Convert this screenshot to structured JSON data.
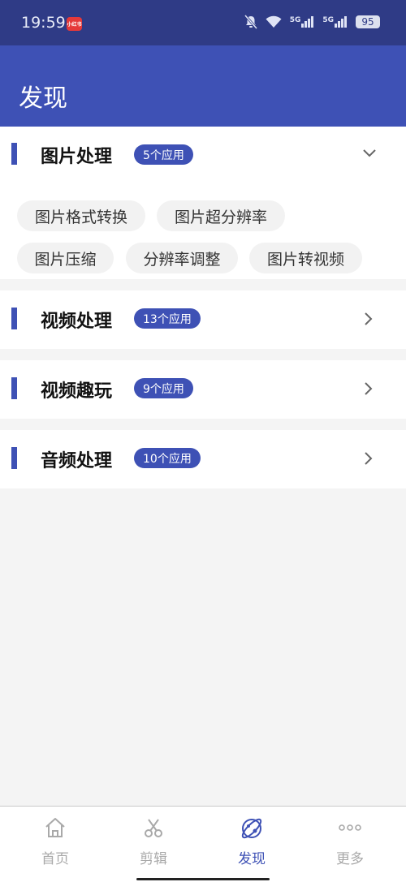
{
  "status_bar": {
    "time": "19:59",
    "app_badge": "小红书",
    "signal_1": "5G",
    "signal_2": "5G",
    "battery": "95"
  },
  "header": {
    "title": "发现"
  },
  "sections": [
    {
      "title": "图片处理",
      "count": "5个应用",
      "expanded": true,
      "chips": [
        "图片格式转换",
        "图片超分辨率",
        "图片压缩",
        "分辨率调整",
        "图片转视频"
      ]
    },
    {
      "title": "视频处理",
      "count": "13个应用",
      "expanded": false
    },
    {
      "title": "视频趣玩",
      "count": "9个应用",
      "expanded": false
    },
    {
      "title": "音频处理",
      "count": "10个应用",
      "expanded": false
    }
  ],
  "bottom_nav": {
    "items": [
      {
        "label": "首页",
        "icon": "home-icon"
      },
      {
        "label": "剪辑",
        "icon": "scissors-icon"
      },
      {
        "label": "发现",
        "icon": "discover-icon",
        "active": true
      },
      {
        "label": "更多",
        "icon": "more-icon"
      }
    ]
  },
  "colors": {
    "primary": "#3e51b5",
    "status_bar": "#2f3b86",
    "background": "#f4f4f4"
  }
}
